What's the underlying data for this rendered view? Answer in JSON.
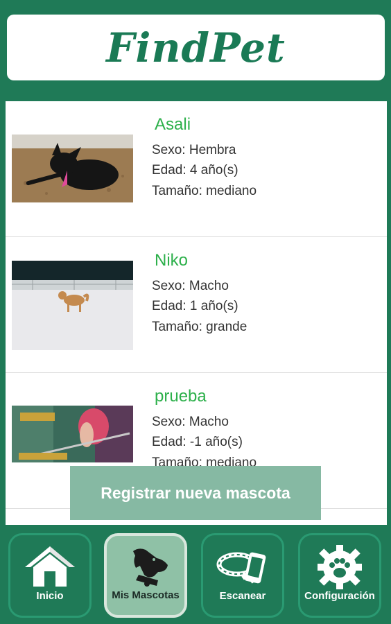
{
  "header": {
    "logo_text": "FindPet"
  },
  "pets": [
    {
      "name": "Asali",
      "sexo": "Sexo: Hembra",
      "edad": "Edad: 4 año(s)",
      "tamano": "Tamaño: mediano"
    },
    {
      "name": "Niko",
      "sexo": "Sexo: Macho",
      "edad": "Edad: 1 año(s)",
      "tamano": "Tamaño: grande"
    },
    {
      "name": "prueba",
      "sexo": "Sexo: Macho",
      "edad": "Edad: -1 año(s)",
      "tamano": "Tamaño: mediano"
    }
  ],
  "register_button": "Registrar nueva mascota",
  "nav": [
    {
      "label": "Inicio",
      "icon": "house-icon",
      "active": false
    },
    {
      "label": "Mis Mascotas",
      "icon": "dog-icon",
      "active": true
    },
    {
      "label": "Escanear",
      "icon": "collar-phone-icon",
      "active": false
    },
    {
      "label": "Configuración",
      "icon": "paw-gear-icon",
      "active": false
    }
  ],
  "colors": {
    "primary": "#1f7a57",
    "name_green": "#2db04b",
    "button": "#86b9a3"
  }
}
